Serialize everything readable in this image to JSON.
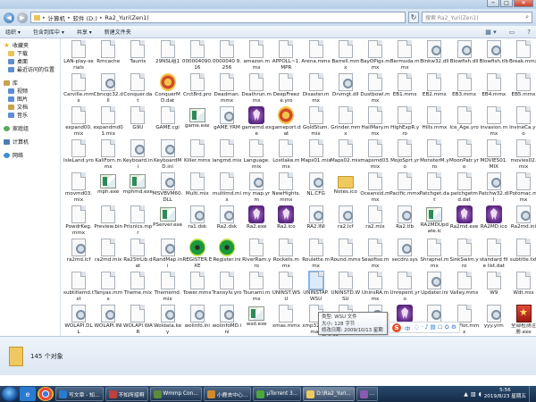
{
  "window": {
    "min": "─",
    "max": "□",
    "close": "✕"
  },
  "addressbar": {
    "path": [
      "计算机",
      "软件 (D:)",
      "Ra2_Yuri(Zen1)"
    ],
    "search_placeholder": "搜索 Ra2_Yuri(Zen1)"
  },
  "toolbar": {
    "organize": "组织 ▾",
    "include": "包含到库中 ▾",
    "share": "共享 ▾",
    "new_folder": "新建文件夹"
  },
  "sidebar": {
    "items": [
      {
        "label": "收藏夹",
        "icon": "star-icon",
        "indent": false,
        "gap": false
      },
      {
        "label": "下载",
        "icon": "folder-icon",
        "indent": true,
        "gap": false
      },
      {
        "label": "桌面",
        "icon": "desktop-icon",
        "indent": true,
        "gap": false
      },
      {
        "label": "最近访问的位置",
        "icon": "recent-icon",
        "indent": true,
        "gap": false
      },
      {
        "label": "库",
        "icon": "library-icon",
        "indent": false,
        "gap": true
      },
      {
        "label": "视频",
        "icon": "video-icon",
        "indent": true,
        "gap": false
      },
      {
        "label": "图片",
        "icon": "pictures-icon",
        "indent": true,
        "gap": false
      },
      {
        "label": "文档",
        "icon": "documents-icon",
        "indent": true,
        "gap": false
      },
      {
        "label": "音乐",
        "icon": "music-icon",
        "indent": true,
        "gap": false
      },
      {
        "label": "家庭组",
        "icon": "homegroup-icon",
        "indent": false,
        "gap": true
      },
      {
        "label": "计算机",
        "icon": "computer-icon",
        "indent": false,
        "gap": true
      },
      {
        "label": "网络",
        "icon": "network-icon",
        "indent": false,
        "gap": true
      }
    ]
  },
  "files": [
    [
      "LAN-play-serials",
      "Rmcache",
      "Taunts",
      "29NSL组1",
      "000004090.16",
      "0000040 9.256",
      "amazon.mmx",
      "APPOLL~1.MPR",
      "Arena.mmx",
      "BarrelI.mmx",
      "BayOPigs.mmx",
      "Bermuda.mmx",
      "Binkw32.dll",
      "Blowfish.dll",
      "Blowfish.tlb",
      "Break.mmx"
    ],
    [
      "Carville.mmx",
      "Cbncqc32.dll",
      "Conquer.dat",
      "ConquerMD.dat",
      "Crct8rd.pro",
      "Deadman.mmx",
      "Deathrun.mmx",
      "DeepFreeze.yro",
      "Disaster.mmx",
      "Drvmgt.dll",
      "Dustbowl.mmx",
      "EB1.mmx",
      "EB2.mmx",
      "EB3.mmx",
      "EB4.mmx",
      "EB5.mmx"
    ],
    [
      "expand00.mix",
      "expandmd01.mix",
      "G9U",
      "GAME.cgi",
      "game.exe",
      "gAME.YRM",
      "gamemd.exe",
      "gameport.dat",
      "GoldStum.mix",
      "Grinder.mmx",
      "HailMary.mmx",
      "HighExpR.yro",
      "Hills.mmx",
      "Ice_Age.yro",
      "invasion.mmx",
      "InvineCa.yro"
    ],
    [
      "IsleLand.yro",
      "KaliForn.mmx",
      "Keyboard.ini",
      "KeyboardMD.ini",
      "Killer.mmx",
      "langmd.mix",
      "Language.mix",
      "Lostlake.mmx",
      "Maps01.mix",
      "Maps02.mix",
      "mapsmd03.mix",
      "MojoSprt.yro",
      "MonsterM.yro",
      "MoonPatr.yro",
      "MOVIES01.MIX",
      "movies02.mix"
    ],
    [
      "movmd03.mix",
      "mph.exe",
      "mphmd.exe",
      "MSVBVM60.DLL",
      "Multi.mix",
      "multimd.mix",
      "my map.yrm",
      "NewHights.mmx",
      "NL.CFG",
      "Notes.ico",
      "Oceansid.mmx",
      "Pacific.mmx",
      "Patchget.dat",
      "patchgetmd.dat",
      "Patchw32.dll",
      "Potomac.mmx"
    ],
    [
      "PowdrKeg.mmx",
      "Preview.bin",
      "Prisnics.mpr",
      "PServer.exe",
      "ra1.dsk",
      "Ra2.dsk",
      "Ra2.exe",
      "Ra2.ico",
      "RA2.INI",
      "ra2.lcf",
      "ra2.mix",
      "Ra2.tlb",
      "RA2MDUpdate.ic",
      "Ra2md.exe",
      "RA2MD.ico",
      "Ra2md.ini"
    ],
    [
      "ra2md.lcf",
      "ra2md.mix",
      "Ra2StrLib.dat",
      "RandMap.ini",
      "REGISTER.EXE",
      "Register.ini",
      "RiverRam.yro",
      "Rockets.mmx",
      "Roulette.mmx",
      "Round.mmx",
      "Seaofiso.mmx",
      "secdrv.sys",
      "Shrapnel.mmx",
      "SinkSwim.yro",
      "standard file list.dat",
      "subtitle.txt"
    ],
    [
      "subtitlemd.txt",
      "Tanyas.mmx",
      "Theme.mix",
      "Thememd.mix",
      "Tower.mmx",
      "Transylv.yro",
      "Tsunami.mmx",
      "UNINST.WSU",
      "UNINSTAP.WSU",
      "UNINSTD.WSU",
      "UninsRA.mmx",
      "Unrepent.yro",
      "Updater.ini",
      "Valley.mmx",
      "W9",
      "Wdt.mix"
    ],
    [
      "WOLAPI.DLL",
      "WOLAPI.INI",
      "WOLAPI.WAR",
      "Woldata.key",
      "wolinfo.ini",
      "wolinfoMD.ini",
      "wsd.exe",
      "xmas.mmx",
      "xmp32mw.map",
      "Xpandoramap.mpr",
      "YR1.dsk",
      "YURI.exe",
      "yuri.lcf",
      "YuriPlot.mmx",
      "yyy.yrm",
      "全部检测注册.exe"
    ],
    [
      "进入游戏.EXE"
    ]
  ],
  "tooltip": {
    "line1": "类型: WSU 文件",
    "line2": "大小: 128 字节",
    "line3": "修改日期: 2009/10/13 星期二 0:35"
  },
  "ime": {
    "logo": "S",
    "label": "中",
    "tools": "◌ · ♪ ▤ ☖ ⛭ ⚙"
  },
  "details": {
    "count": "145 个对象"
  },
  "taskbar": {
    "buttons": [
      "写文章 - 知...",
      "不知所措啊",
      "Wmmp Con...",
      "小鹿去中心...",
      "µTorrent 3...",
      "D:\\Ra2_Yuri...",
      "..."
    ],
    "time": "5:56",
    "date": "2019/8/23 星期五"
  },
  "colors": {
    "accent": "#2c6cb0",
    "taskbar": "#142b48",
    "folder": "#f0c860"
  }
}
